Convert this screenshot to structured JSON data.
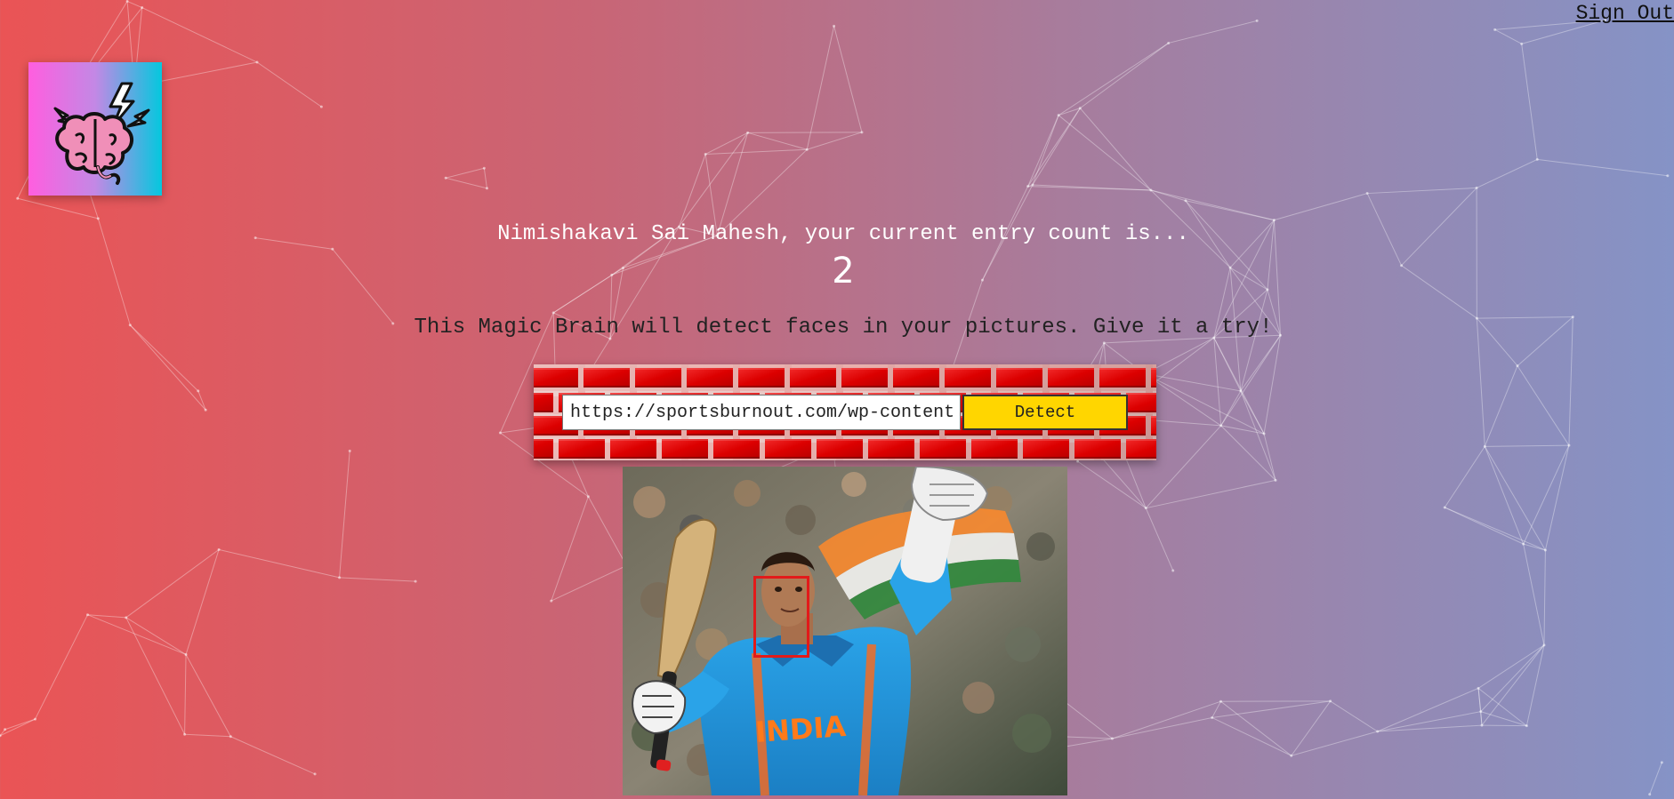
{
  "header": {
    "signout_label": "Sign Out"
  },
  "logo": {
    "icon": "brain-icon"
  },
  "rank": {
    "message": "Nimishakavi Sai Mahesh, your current entry count is...",
    "count": "2"
  },
  "tagline": "This Magic Brain will detect faces in your pictures. Give it a try!",
  "image_form": {
    "url_value": "https://sportsburnout.com/wp-content",
    "detect_label": "Detect"
  },
  "result": {
    "image_icon": "cricket-player-photo",
    "face_box_color": "#e21a1a",
    "faces_detected_shown": 1,
    "jersey_text": "INDIA"
  },
  "colors": {
    "gradient_left": "#ea5455",
    "gradient_right": "#8593c6",
    "button": "#ffd600",
    "brick": "#dc0000"
  }
}
